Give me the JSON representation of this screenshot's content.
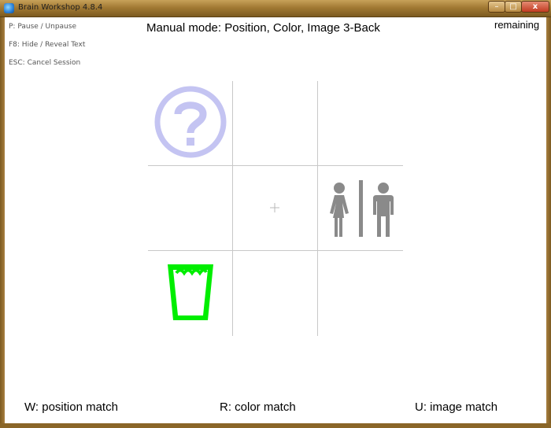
{
  "window": {
    "title": "Brain Workshop 4.8.4",
    "controls": {
      "minimize": "–",
      "maximize": "□",
      "close": "x"
    }
  },
  "hints": [
    "P: Pause / Unpause",
    "F8: Hide / Reveal Text",
    "ESC: Cancel Session"
  ],
  "header": {
    "mode_title": "Manual mode: Position, Color, Image 3-Back",
    "remaining_label": "remaining"
  },
  "grid": {
    "rows": 3,
    "cols": 3,
    "line_color": "#c8c8c8",
    "stimuli": [
      {
        "row": 0,
        "col": 0,
        "icon": "question-mark-icon",
        "color": "#c4c4f2"
      },
      {
        "row": 1,
        "col": 2,
        "icon": "restroom-icon",
        "color": "#8a8a8a"
      },
      {
        "row": 2,
        "col": 0,
        "icon": "water-glass-icon",
        "color": "#00ee00"
      }
    ],
    "center_marker": "fixation-cross"
  },
  "controls": [
    {
      "key": "W",
      "label": "W: position match"
    },
    {
      "key": "R",
      "label": "R: color match"
    },
    {
      "key": "U",
      "label": "U: image match"
    }
  ]
}
